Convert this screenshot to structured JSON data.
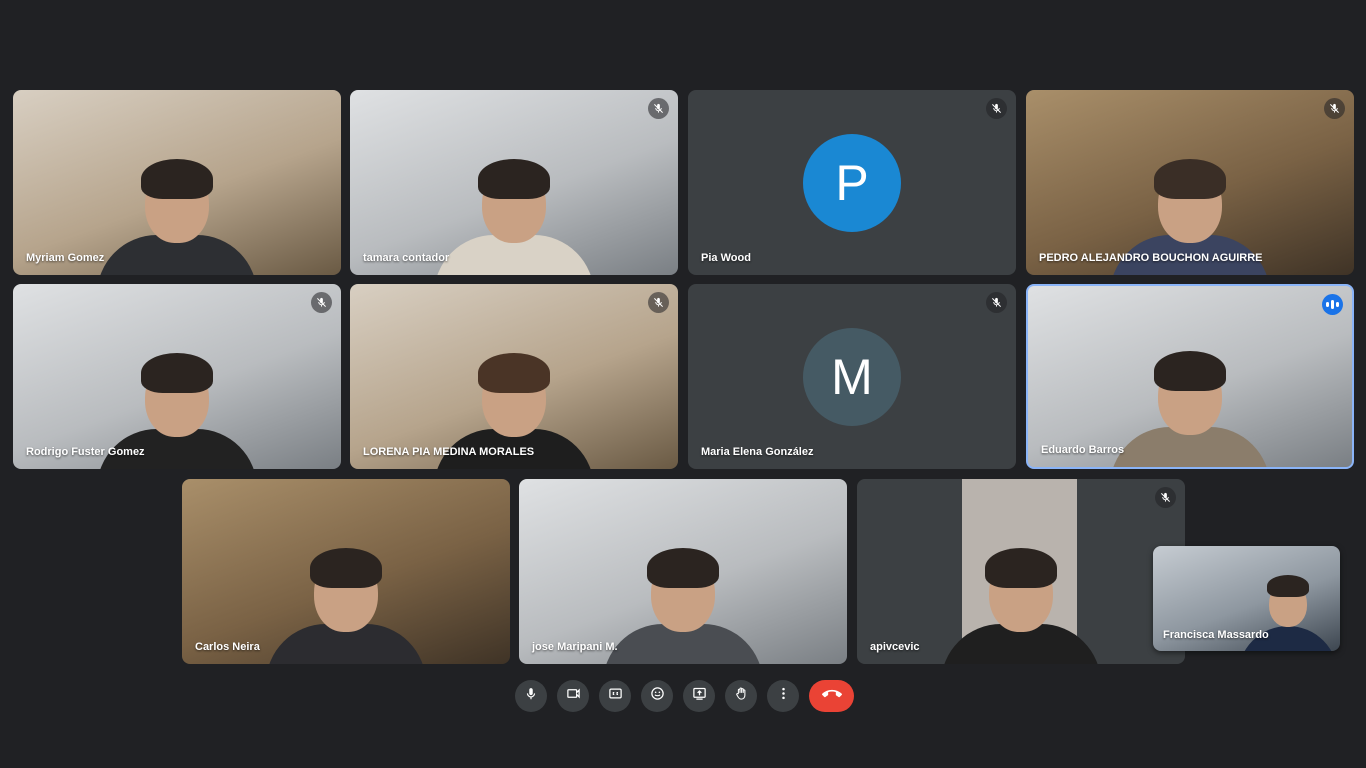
{
  "participants": [
    {
      "name": "Myriam Gomez",
      "muted": false
    },
    {
      "name": "tamara contador",
      "muted": true
    },
    {
      "name": "Pia Wood",
      "muted": true,
      "avatar_letter": "P",
      "avatar_color": "#1a88d3"
    },
    {
      "name": "PEDRO ALEJANDRO BOUCHON AGUIRRE",
      "muted": true
    },
    {
      "name": "Rodrigo Fuster Gomez",
      "muted": true
    },
    {
      "name": "LORENA PIA MEDINA MORALES",
      "muted": true
    },
    {
      "name": "Maria Elena González",
      "muted": true,
      "avatar_letter": "M",
      "avatar_color": "#455a64"
    },
    {
      "name": "Eduardo Barros",
      "muted": false,
      "speaking": true
    },
    {
      "name": "Carlos Neira",
      "muted": false
    },
    {
      "name": "jose Maripani M.",
      "muted": false
    },
    {
      "name": "apivcevic",
      "muted": true
    }
  ],
  "self_view": {
    "name": "Francisca Massardo"
  },
  "toolbar": {
    "buttons": [
      "mic-icon",
      "camera-icon",
      "captions-icon",
      "emoji-icon",
      "present-icon",
      "raise-hand-icon",
      "more-options-icon"
    ],
    "end_call": "end-call-icon",
    "end_call_color": "#ea4335"
  },
  "colors": {
    "background": "#202124",
    "tile_blank": "#3c4043",
    "active_border": "#8ab4f8",
    "speaking_badge": "#1a73e8"
  }
}
